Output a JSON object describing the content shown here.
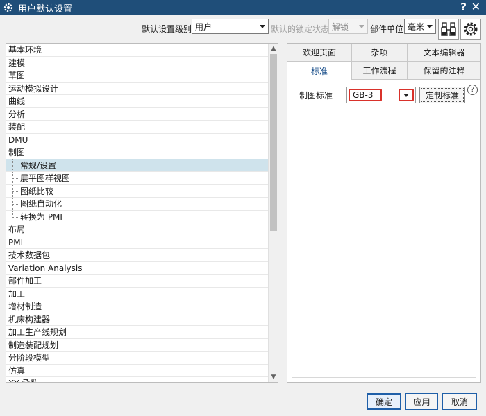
{
  "window": {
    "title": "用户默认设置",
    "help_label": "?",
    "close_label": "✕"
  },
  "toolbar": {
    "level_label": "默认设置级别",
    "level_value": "用户",
    "lock_label": "默认的锁定状态",
    "lock_value": "解锁",
    "unit_label": "部件单位",
    "unit_value": "毫米"
  },
  "tree": {
    "items": [
      {
        "label": "基本环境"
      },
      {
        "label": "建模"
      },
      {
        "label": "草图"
      },
      {
        "label": "运动模拟设计"
      },
      {
        "label": "曲线"
      },
      {
        "label": "分析"
      },
      {
        "label": "装配"
      },
      {
        "label": "DMU"
      },
      {
        "label": "制图"
      },
      {
        "label": "常规/设置"
      },
      {
        "label": "展平图样视图"
      },
      {
        "label": "图纸比较"
      },
      {
        "label": "图纸自动化"
      },
      {
        "label": "转换为 PMI"
      },
      {
        "label": "布局"
      },
      {
        "label": "PMI"
      },
      {
        "label": "技术数据包"
      },
      {
        "label": "Variation Analysis"
      },
      {
        "label": "部件加工"
      },
      {
        "label": "加工"
      },
      {
        "label": "增材制造"
      },
      {
        "label": "机床构建器"
      },
      {
        "label": "加工生产线规划"
      },
      {
        "label": "制造装配规划"
      },
      {
        "label": "分阶段模型"
      },
      {
        "label": "仿真"
      },
      {
        "label": "XY 函数"
      }
    ]
  },
  "tabs": {
    "row1": [
      "欢迎页面",
      "杂项",
      "文本编辑器"
    ],
    "row2": [
      "标准",
      "工作流程",
      "保留的注释"
    ],
    "active": "标准"
  },
  "standard": {
    "label": "制图标准",
    "value": "GB-3",
    "customize_label": "定制标准",
    "help_label": "?"
  },
  "footer": {
    "ok": "确定",
    "apply": "应用",
    "cancel": "取消"
  },
  "colors": {
    "titlebar": "#1f4e79",
    "highlight": "#d9322b",
    "selected": "#cfe3ec"
  }
}
